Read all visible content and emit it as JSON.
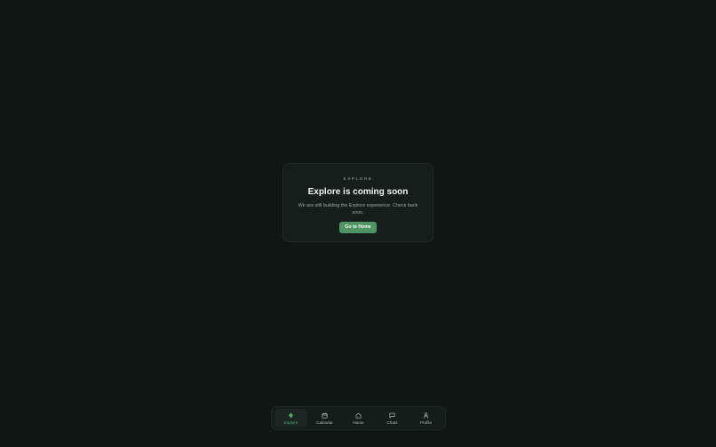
{
  "card": {
    "eyebrow": "EXPLORE",
    "title": "Explore is coming soon",
    "description": "We are still building the Explore experience. Check back soon.",
    "button_label": "Go to Home"
  },
  "nav": {
    "items": [
      {
        "label": "Explore",
        "icon": "diamond-icon",
        "active": true
      },
      {
        "label": "Calendar",
        "icon": "calendar-icon",
        "active": false
      },
      {
        "label": "Home",
        "icon": "home-icon",
        "active": false
      },
      {
        "label": "Chats",
        "icon": "chat-icon",
        "active": false
      },
      {
        "label": "Profile",
        "icon": "user-icon",
        "active": false
      }
    ]
  },
  "colors": {
    "background": "#0f1614",
    "card": "#161e1b",
    "accent": "#4f9462",
    "active_label": "#58a36d"
  }
}
